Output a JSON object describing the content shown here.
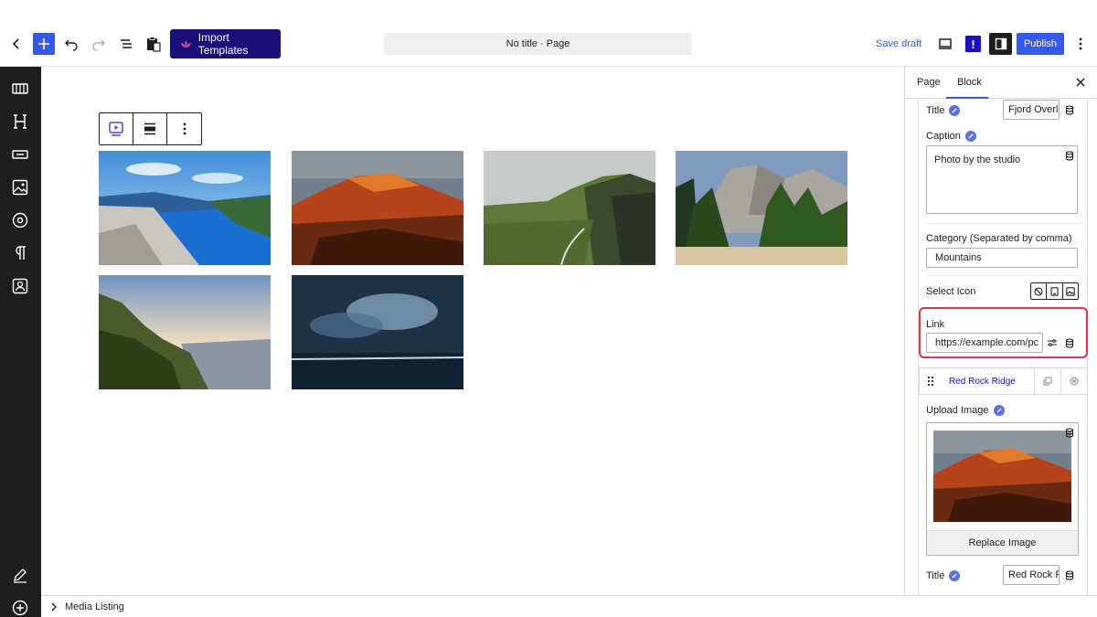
{
  "toolbar": {
    "import_label": "Import Templates",
    "doc_title": "No title · Page",
    "save_draft_label": "Save draft",
    "excl_label": "!",
    "publish_label": "Publish"
  },
  "breadcrumb": {
    "label": "Media Listing"
  },
  "panel": {
    "tabs": [
      "Page",
      "Block"
    ],
    "active_tab": "Block",
    "title_label": "Title",
    "title_value": "Fjord Overlc",
    "caption_label": "Caption",
    "caption_value": "Photo by the studio",
    "category_label": "Category (Separated by comma)",
    "category_value": "Mountains",
    "select_icon_label": "Select Icon",
    "link_label": "Link",
    "link_value": "https://example.com/pc",
    "item2": {
      "title": "Red Rock Ridge",
      "upload_label": "Upload Image",
      "replace_label": "Replace Image",
      "title_label": "Title",
      "title_value": "Red Rock Ri"
    }
  },
  "colors": {
    "accent": "#3858e9",
    "import_bg": "#1a0f7a",
    "highlight": "#e0314a",
    "sidebar_bg": "#1e1e1e"
  },
  "gallery": {
    "images": [
      "fjord-overlook",
      "red-rock-ridge",
      "green-cliffs",
      "forest-valley",
      "coastal-sunset",
      "storm-sea"
    ]
  }
}
